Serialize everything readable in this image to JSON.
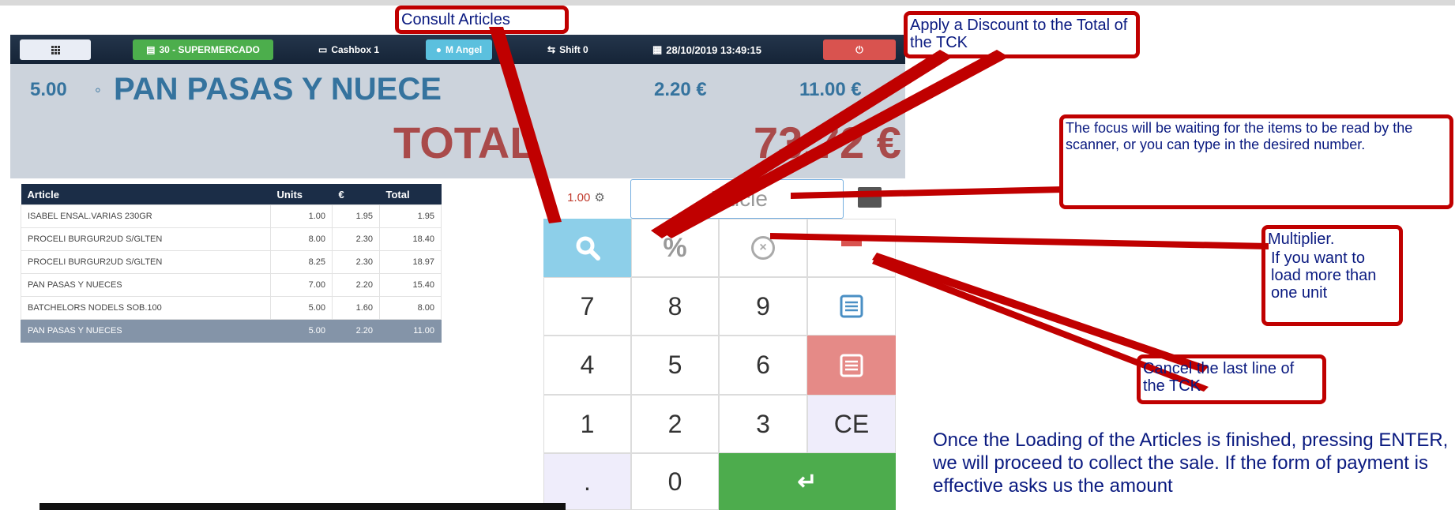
{
  "navbar": {
    "store": "30 - SUPERMERCADO",
    "cashbox": "Cashbox 1",
    "user": "M Angel",
    "shift": "Shift 0",
    "datetime": "28/10/2019 13:49:15"
  },
  "last_line": {
    "units": "5.00",
    "article": "PAN PASAS Y NUECE",
    "price": "2.20 €",
    "total": "11.00 €"
  },
  "total": {
    "label": "TOTAL",
    "value": "73.72 €"
  },
  "ticket": {
    "headers": [
      "Article",
      "Units",
      "€",
      "Total"
    ],
    "rows": [
      [
        "ISABEL ENSAL.VARIAS 230GR",
        "1.00",
        "1.95",
        "1.95"
      ],
      [
        "PROCELI BURGUR2UD S/GLTEN",
        "8.00",
        "2.30",
        "18.40"
      ],
      [
        "PROCELI BURGUR2UD S/GLTEN",
        "8.25",
        "2.30",
        "18.97"
      ],
      [
        "PAN PASAS Y NUECES",
        "7.00",
        "2.20",
        "15.40"
      ],
      [
        "BATCHELORS NODELS SOB.100",
        "5.00",
        "1.60",
        "8.00"
      ],
      [
        "PAN PASAS Y NUECES",
        "5.00",
        "2.20",
        "11.00"
      ]
    ]
  },
  "input": {
    "multiplier": "1.00",
    "placeholder": "Article"
  },
  "keypad": {
    "k7": "7",
    "k8": "8",
    "k9": "9",
    "k4": "4",
    "k5": "5",
    "k6": "6",
    "k1": "1",
    "k2": "2",
    "k3": "3",
    "ce": "CE",
    "dot": ".",
    "k0": "0",
    "percent": "%"
  },
  "callouts": {
    "consult": "Consult Articles",
    "discount": "Apply a Discount to the Total of the TCK",
    "focus": "The focus will be waiting for the items to be read by the scanner, or you can type in the desired number.",
    "multiplier_title": "Multiplier.",
    "multiplier_body": "If you want to load more than one unit",
    "cancel": "Cancel the last line of the TCK"
  },
  "info_text": "Once the Loading of the Articles is finished, pressing ENTER, we will proceed to collect the sale.  If the form of payment is effective asks us the amount",
  "colors": {
    "navbar": "#1b2d47",
    "accent_red": "#c00000",
    "store_green": "#4cae4c",
    "user_blue": "#5bc0de",
    "power_red": "#d9534f",
    "total_red": "#a94a4a"
  }
}
